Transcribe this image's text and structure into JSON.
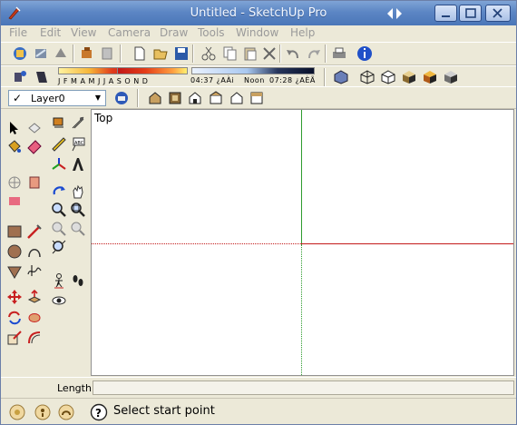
{
  "window": {
    "title": "Untitled - SketchUp Pro"
  },
  "menu": [
    "File",
    "Edit",
    "View",
    "Camera",
    "Draw",
    "Tools",
    "Window",
    "Help"
  ],
  "shadows": {
    "months_label": "J F M A M J J A S O N D",
    "time_start": "04:37 ¿AÀi",
    "time_mid": "Noon",
    "time_end": "07:28 ¿AÈÃ"
  },
  "layers": {
    "current": "Layer0"
  },
  "viewport": {
    "view_name": "Top"
  },
  "measurements": {
    "label": "Length",
    "value": ""
  },
  "status": {
    "message": "Select start point"
  },
  "colors": {
    "axis_red": "#c41a1a",
    "axis_green": "#2e9b2e",
    "titlebar": "#5c86c4"
  }
}
